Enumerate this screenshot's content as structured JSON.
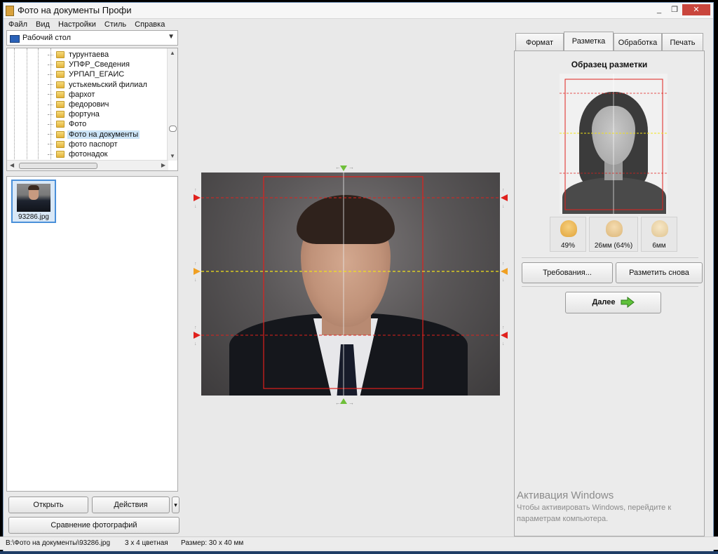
{
  "window": {
    "title": "Фото на документы Профи",
    "controls": [
      "_",
      "❐",
      "✕"
    ]
  },
  "menu": [
    "Файл",
    "Вид",
    "Настройки",
    "Стиль",
    "Справка"
  ],
  "browser": {
    "location": "Рабочий стол",
    "folders": [
      {
        "name": "турунтаева",
        "selected": false
      },
      {
        "name": "УПФР_Сведения",
        "selected": false
      },
      {
        "name": "УРПАП_ЕГАИС",
        "selected": false
      },
      {
        "name": "устькемьский филиал",
        "selected": false
      },
      {
        "name": "фархот",
        "selected": false
      },
      {
        "name": "федорович",
        "selected": false
      },
      {
        "name": "фортуна",
        "selected": false
      },
      {
        "name": "Фото",
        "selected": false
      },
      {
        "name": "Фото на документы",
        "selected": true
      },
      {
        "name": "фото паспорт",
        "selected": false
      },
      {
        "name": "фотонадок",
        "selected": false
      }
    ],
    "thumbnail": {
      "filename": "93286.jpg"
    }
  },
  "left_buttons": {
    "open": "Открыть",
    "actions": "Действия",
    "actions_dropdown": "▾",
    "compare": "Сравнение фотографий"
  },
  "tabs": [
    {
      "label": "Формат",
      "active": false
    },
    {
      "label": "Разметка",
      "active": true
    },
    {
      "label": "Обработка",
      "active": false
    },
    {
      "label": "Печать",
      "active": false
    }
  ],
  "markup_panel": {
    "title": "Образец разметки",
    "metrics": [
      {
        "icon": "head-size-icon",
        "value": "49%"
      },
      {
        "icon": "face-height-icon",
        "value": "26мм (64%)"
      },
      {
        "icon": "eye-distance-icon",
        "value": "6мм"
      }
    ],
    "requirements_button": "Требования...",
    "remark_button": "Разметить снова",
    "next_button": "Далее"
  },
  "watermark": {
    "line1": "Активация Windows",
    "line2": "Чтобы активировать Windows, перейдите к",
    "line3": "параметрам компьютера."
  },
  "status": {
    "path": "В:\\Фото на документы\\93286.jpg",
    "format": "3 x 4 цветная",
    "size": "Размер: 30 x 40 мм"
  },
  "colors": {
    "accent_red": "#e0211d",
    "accent_yellow": "#f2e21a",
    "marker_green": "#6fbf3a",
    "marker_orange": "#f0a023",
    "selection": "#4a90d9"
  }
}
